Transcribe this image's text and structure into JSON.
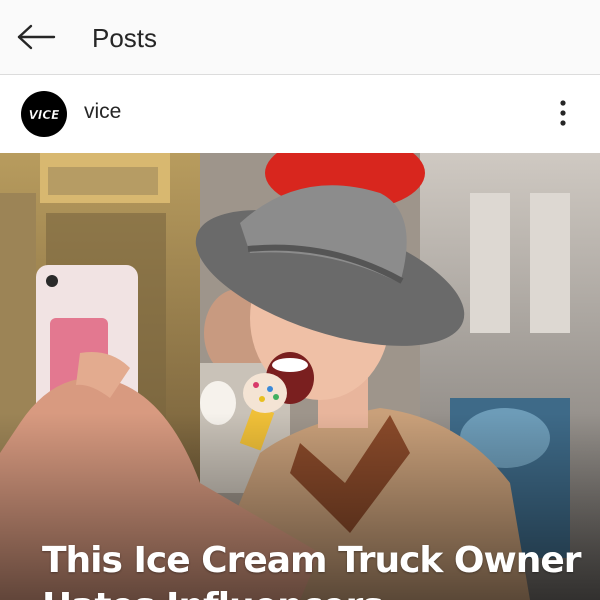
{
  "topbar": {
    "title": "Posts",
    "back_icon": "arrow-left-icon"
  },
  "post": {
    "username": "vice",
    "avatar_logo_text": "VICE",
    "more_icon": "more-vertical-icon",
    "image": {
      "description_icon": "post-photo",
      "headline": "This Ice Cream Truck Owner Hates Influencers"
    }
  },
  "colors": {
    "topbar_bg": "#fafafa",
    "text": "#262626",
    "avatar_bg": "#000000",
    "headline": "#ffffff"
  }
}
